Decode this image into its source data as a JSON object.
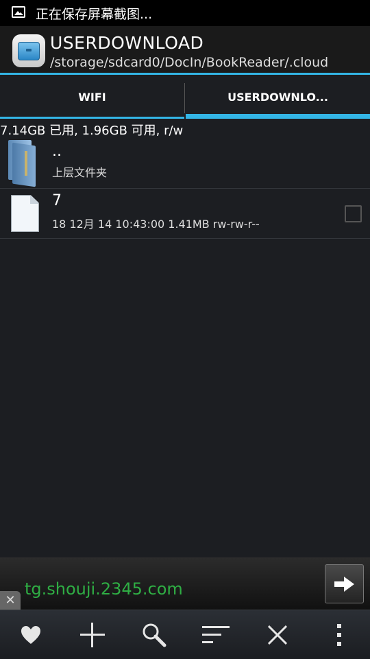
{
  "status_bar": {
    "notification_icon": "image-icon",
    "notification_text": "正在保存屏幕截图..."
  },
  "action_bar": {
    "app_icon": "file-manager-icon",
    "title": "USERDOWNLOAD",
    "path": "/storage/sdcard0/DocIn/BookReader/.cloud"
  },
  "tabs": [
    {
      "label": "WIFI",
      "selected": false
    },
    {
      "label": "USERDOWNLO...",
      "selected": true
    }
  ],
  "storage_info": "7.14GB 已用, 1.96GB 可用, r/w",
  "file_list": [
    {
      "name": "..",
      "detail": "上层文件夹",
      "icon": "folder-icon"
    },
    {
      "name": "7",
      "detail": "18 12月 14 10:43:00  1.41MB  rw-rw-r--",
      "icon": "document-icon",
      "checked": false
    }
  ],
  "ad_banner": {
    "url_text": "tg.shouji.2345.com",
    "arrow_icon": "arrow-right-icon",
    "close_icon": "close-icon"
  },
  "bottom_toolbar": [
    {
      "icon": "heart-icon"
    },
    {
      "icon": "plus-icon"
    },
    {
      "icon": "search-icon"
    },
    {
      "icon": "sort-icon"
    },
    {
      "icon": "close-icon"
    },
    {
      "icon": "overflow-menu-icon"
    }
  ],
  "colors": {
    "accent": "#33b5e5",
    "ad_link": "#2fae44",
    "background": "#1c1e22"
  }
}
